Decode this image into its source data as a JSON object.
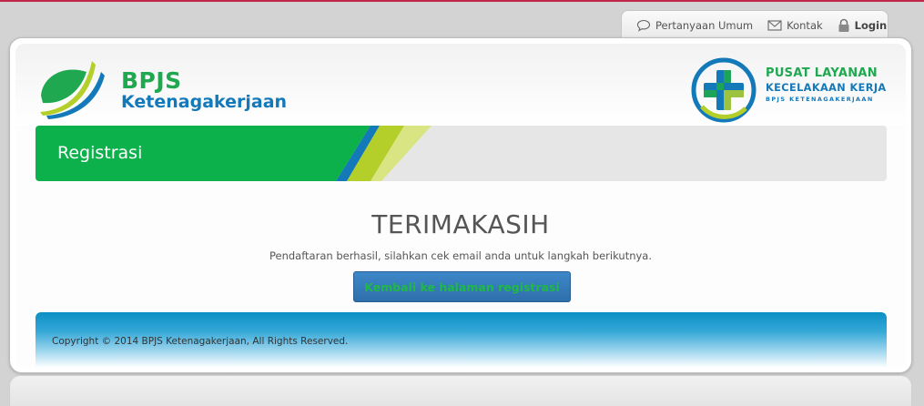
{
  "topnav": {
    "faq_label": "Pertanyaan Umum",
    "contact_label": "Kontak",
    "login_label": "Login"
  },
  "brand": {
    "title": "BPJS",
    "subtitle": "Ketenagakerjaan"
  },
  "pusat": {
    "line1": "PUSAT LAYANAN",
    "line2": "KECELAKAAN KERJA",
    "line3": "BPJS KETENAGAKERJAAN"
  },
  "page": {
    "section_title": "Registrasi",
    "heading": "TERIMAKASIH",
    "message": "Pendaftaran berhasil, silahkan cek email anda untuk langkah berikutnya.",
    "back_button_label": "Kembali ke halaman registrasi"
  },
  "footer": {
    "copyright": "Copyright © 2014 BPJS Ketenagakerjaan, All Rights Reserved."
  },
  "colors": {
    "brand_green": "#1fa84f",
    "brand_blue": "#1479b8",
    "button_blue": "#3479b9",
    "footer_blue": "#0c8fc4",
    "accent_red": "#c0264a"
  }
}
